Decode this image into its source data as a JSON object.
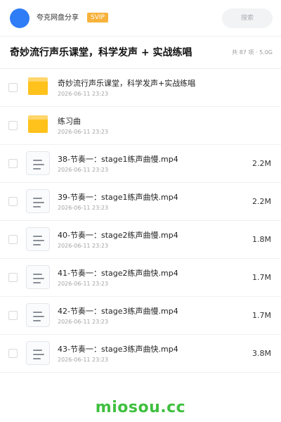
{
  "header": {
    "share_name": "夸克网盘分享",
    "badge": "SVIP",
    "search_placeholder": "搜索"
  },
  "folder": {
    "title": "奇妙流行声乐课堂，科学发声 + 实战练唱",
    "meta": "共 87 项 · 5.0G"
  },
  "items": [
    {
      "type": "folder",
      "name": "奇妙流行声乐课堂，科学发声+实战练唱",
      "date": "2026-06-11 23:23",
      "size": ""
    },
    {
      "type": "folder",
      "name": "练习曲",
      "date": "2026-06-11 23:23",
      "size": ""
    },
    {
      "type": "file",
      "name": "38-节奏一：stage1练声曲慢.mp4",
      "date": "2026-06-11 23:23",
      "size": "2.2M"
    },
    {
      "type": "file",
      "name": "39-节奏一：stage1练声曲快.mp4",
      "date": "2026-06-11 23:23",
      "size": "2.2M"
    },
    {
      "type": "file",
      "name": "40-节奏一：stage2练声曲慢.mp4",
      "date": "2026-06-11 23:23",
      "size": "1.8M"
    },
    {
      "type": "file",
      "name": "41-节奏一：stage2练声曲快.mp4",
      "date": "2026-06-11 23:23",
      "size": "1.7M"
    },
    {
      "type": "file",
      "name": "42-节奏一：stage3练声曲慢.mp4",
      "date": "2026-06-11 23:23",
      "size": "1.7M"
    },
    {
      "type": "file",
      "name": "43-节奏一：stage3练声曲快.mp4",
      "date": "2026-06-11 23:23",
      "size": "3.8M"
    }
  ],
  "footer": {
    "watermark": "miosou.cc"
  },
  "colors": {
    "avatar": "#2f7df6",
    "badge": "#f7b23b",
    "folder": "#ffc21c",
    "watermark": "#3fbf3f"
  }
}
